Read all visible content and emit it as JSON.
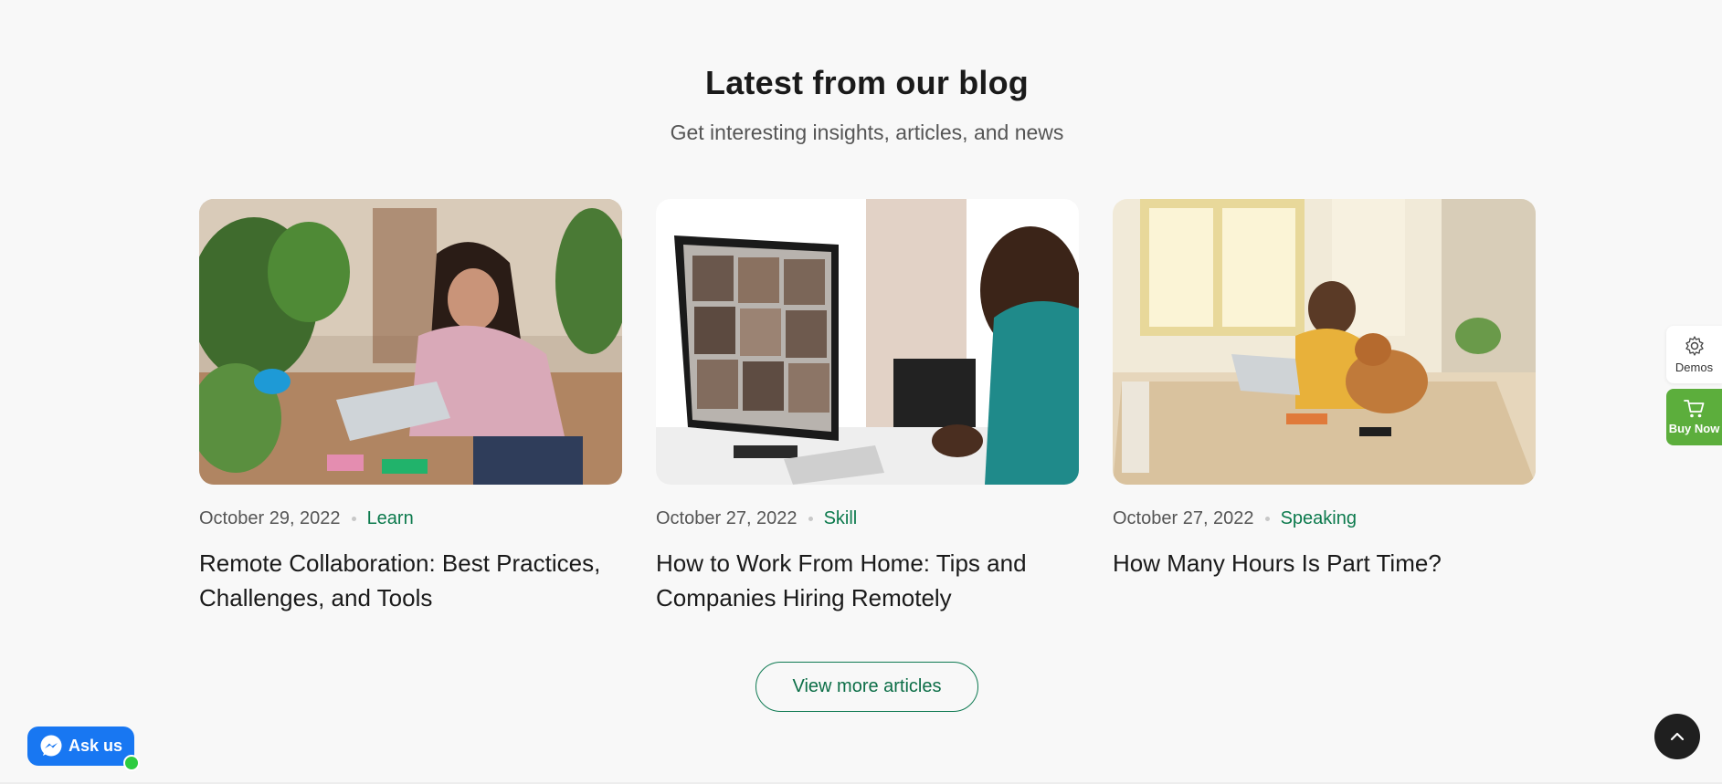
{
  "blog": {
    "title": "Latest from our blog",
    "subtitle": "Get interesting insights, articles, and news",
    "posts": [
      {
        "date": "October 29, 2022",
        "category": "Learn",
        "title": "Remote Collaboration: Best Practices, Challenges, and Tools"
      },
      {
        "date": "October 27, 2022",
        "category": "Skill",
        "title": "How to Work From Home: Tips and Companies Hiring Remotely"
      },
      {
        "date": "October 27, 2022",
        "category": "Speaking",
        "title": "How Many Hours Is Part Time?"
      }
    ],
    "view_more_label": "View more articles"
  },
  "sidebar": {
    "demos_label": "Demos",
    "buy_label": "Buy Now"
  },
  "chat": {
    "label": "Ask us"
  },
  "colors": {
    "accent_green": "#0c7a4d",
    "buy_green": "#5cae3c",
    "messenger_blue": "#1877f2"
  },
  "icons": [
    "gear-icon",
    "cart-icon",
    "messenger-icon",
    "chevron-up-icon"
  ]
}
